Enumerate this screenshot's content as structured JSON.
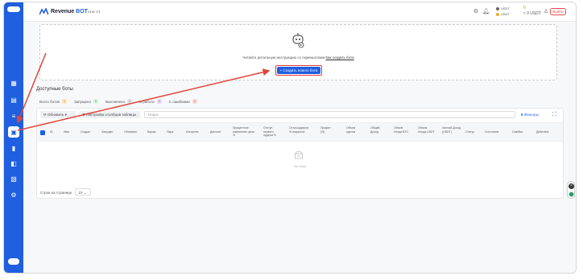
{
  "app": {
    "brand_first": "Revenue",
    "brand_second": "BOT",
    "version": "v1кс V1",
    "exit_label": "Выйти",
    "balance_line1": "USDT",
    "balance_line2": "USDT",
    "coins_count": "0",
    "coins_label": "≈ 0 USDT"
  },
  "hero": {
    "hint_text": "Читайте детальную инструкцию со скриншотами",
    "hint_link": "Как создать бота",
    "create_button": "+ Создать нового бота"
  },
  "bots": {
    "section_title": "Доступные боты",
    "tabs": [
      {
        "label": "Всего ботов",
        "count": "0"
      },
      {
        "label": "Запущено",
        "count": "0"
      },
      {
        "label": "Выключено",
        "count": "0"
      },
      {
        "label": "В работе",
        "count": "0"
      },
      {
        "label": "С ошибками",
        "count": "0"
      }
    ],
    "refresh_label": "Обновить",
    "columns_label": "Настройка столбцов таблицы",
    "search_placeholder": "Поиск",
    "filters_label": "Фильтры",
    "headers": [
      "ID",
      "Имя",
      "Создан",
      "Запущен",
      "Обновлен",
      "Биржа",
      "Пара",
      "Алгоритм",
      "Депозит",
      "Процентное изменение цены %",
      "Отступ первого ордера %",
      "Сетка ордеров % покрытия",
      "Профит (%)",
      "Объем сделок",
      "Общий Доход",
      "Объем Холда BTC",
      "Объем Холда USDT",
      "Чистый Доход (USDT)",
      "Статус",
      "Состояние",
      "Ошибка",
      "Действия"
    ],
    "no_data": "No Data",
    "per_page_label": "Строк на странице",
    "per_page_value": "10"
  }
}
